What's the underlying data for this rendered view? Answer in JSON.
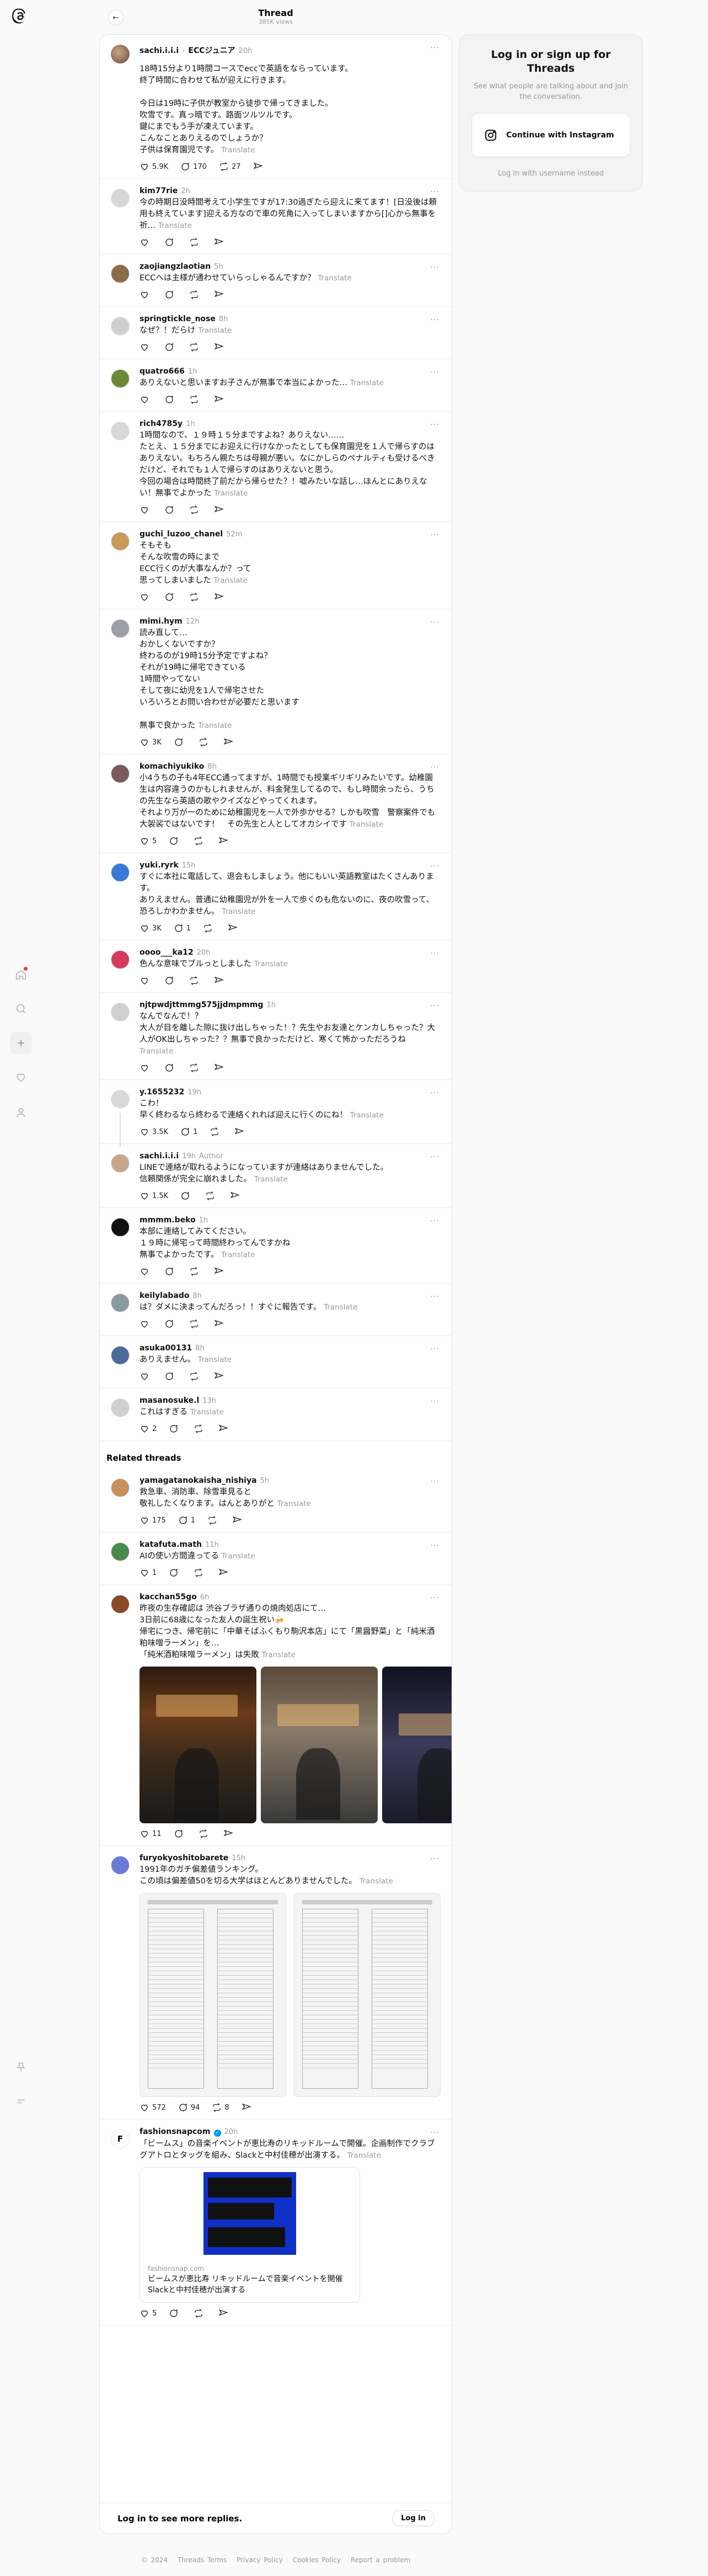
{
  "header": {
    "title": "Thread",
    "views": "385K views"
  },
  "rail": {
    "icons": [
      "home-icon",
      "search-icon",
      "create-icon",
      "heart-icon",
      "profile-icon",
      "pin-icon",
      "menu-icon"
    ]
  },
  "op": {
    "username": "sachi.i.i.i",
    "org": "ECCジュニア",
    "time": "20h",
    "text": "18時15分より1時間コースでeccで英語をならっています。\n終了時間に合わせて私が迎えに行きます。\n\n今日は19時に子供が教室から徒歩で帰ってきました。\n吹雪です。真っ暗です。路面ツルツルです。\n鍵にまでもう手が凍えています。\nこんなことありえるのでしょうか？\n子供は保育園児です。",
    "translate": "Translate",
    "likes": "5.9K",
    "replies": "170",
    "reposts": "27"
  },
  "replies": [
    {
      "user": "kim77rie",
      "time": "2h",
      "text": "今の時期日没時間考えて小学生ですが17:30過ぎたら迎えに来てます！[日没後は頼用も終えています]迎える方なので車の死角に入ってしまいますから[]心から無事を祈…",
      "translate": "Translate",
      "likes": "",
      "replies": "",
      "reposts": ""
    },
    {
      "user": "zaojiangzlaotian",
      "time": "5h",
      "text": "ECCへは主様が通わせていらっしゃるんですか？",
      "translate": "Translate",
      "likes": "",
      "replies": "",
      "reposts": ""
    },
    {
      "user": "springtickle_nose",
      "time": "8h",
      "text": "なぜ？！だらけ",
      "translate": "Translate",
      "likes": "",
      "replies": "",
      "reposts": ""
    },
    {
      "user": "quatro666",
      "time": "1h",
      "text": "ありえないと思いますお子さんが無事で本当によかった…",
      "translate": "Translate",
      "likes": "",
      "replies": "",
      "reposts": ""
    },
    {
      "user": "rich4785y",
      "time": "1h",
      "text": "1時間なので、１９時１５分まですよね？ありえない……\nたとえ、１５分までにお迎えに行けなかったとしても保育園児を１人で帰らすのはありえない。もちろん親たちは母親が悪い。なにかしらのペナルティも受けるべきだけど、それでも１人で帰らすのはありえないと思う。\n今回の場合は時間終了前だから帰らせた？！嘘みたいな話し…ほんとにありえない！無事でよかった",
      "translate": "Translate",
      "likes": "",
      "replies": "",
      "reposts": ""
    },
    {
      "user": "guchi_luzoo_chanel",
      "time": "52m",
      "text": "そもそも\nそんな吹雪の時にまで\nECC行くのが大事なんか？って\n思ってしまいました",
      "translate": "Translate",
      "likes": "",
      "replies": "",
      "reposts": ""
    },
    {
      "user": "mimi.hym",
      "time": "12h",
      "text": "読み直して…\nおかしくないですか？\n終わるのが19時15分予定ですよね？\nそれが19時に帰宅できている\n1時間やってない\nそして夜に幼児を1人で帰宅させた\nいろいろとお問い合わせが必要だと思います\n\n無事で良かった",
      "translate": "Translate",
      "likes": "3K",
      "replies": "",
      "reposts": ""
    },
    {
      "user": "komachiyukiko",
      "time": "8h",
      "text": "小4うちの子も4年ECC通ってますが、1時間でも授業ギリギリみたいです。幼稚園生は内容違うのかもしれませんが、料金発生してるので、もし時間余ったら、うちの先生なら英語の歌やクイズなどやってくれます。\nそれより万が一のために幼稚園児を一人で外歩かせる？しかも吹雪　警察案件でも大袈裟ではないです！　その先生と人としてオカシイです",
      "translate": "Translate",
      "likes": "5",
      "replies": "",
      "reposts": ""
    },
    {
      "user": "yuki.ryrk",
      "time": "15h",
      "text": "すぐに本社に電話して、退会もしましょう。他にもいい英語教室はたくさんあります。\nありえません。普通に幼稚園児が外を一人で歩くのも危ないのに、夜の吹雪って、恐ろしかわかません。",
      "translate": "Translate",
      "likes": "3K",
      "replies": "1",
      "reposts": ""
    },
    {
      "user": "oooo___ka12",
      "time": "20h",
      "text": "色んな意味でブルっとしました",
      "translate": "Translate",
      "likes": "",
      "replies": "",
      "reposts": ""
    },
    {
      "user": "njtpwdjttmmg575jjdmpmmg",
      "time": "1h",
      "text": "なんでなんで！？\n大人が目を離した隙に抜け出しちゃった！？先生やお友達とケンカしちゃった？大人がOK出しちゃった？？無事で良かっただけど、寒くて怖かっただろうね",
      "translate": "Translate",
      "likes": "",
      "replies": "",
      "reposts": ""
    },
    {
      "user": "y.1655232",
      "time": "19h",
      "text": "こわ！\n早く終わるなら終わるで連絡くれれば迎えに行くのにね！",
      "translate": "Translate",
      "likes": "3.5K",
      "replies": "1",
      "reposts": "",
      "thread": true
    },
    {
      "user": "sachi.i.i.i",
      "time": "19h",
      "author": "Author",
      "text": "LINEで連絡が取れるようになっていますが連絡はありませんでした。\n信頼関係が完全に崩れました。",
      "translate": "Translate",
      "likes": "1.5K",
      "replies": "",
      "reposts": ""
    },
    {
      "user": "mmmm.beko",
      "time": "1h",
      "text": "本部に連絡してみてください。\n１９時に帰宅って時間終わってんですかね\n無事でよかったです。",
      "translate": "Translate",
      "likes": "",
      "replies": "",
      "reposts": ""
    },
    {
      "user": "keilylabado",
      "time": "8h",
      "text": "は？ダメに決まってんだろっ！！すぐに報告です。",
      "translate": "Translate",
      "likes": "",
      "replies": "",
      "reposts": ""
    },
    {
      "user": "asuka00131",
      "time": "8h",
      "text": "ありえません。",
      "translate": "Translate",
      "likes": "",
      "replies": "",
      "reposts": ""
    },
    {
      "user": "masanosuke.l",
      "time": "13h",
      "text": "これはすぎる",
      "translate": "Translate",
      "likes": "2",
      "replies": "",
      "reposts": ""
    }
  ],
  "related": {
    "label": "Related threads",
    "items": [
      {
        "user": "yamagatanokaisha_nishiya",
        "time": "5h",
        "text": "救急車、消防車、除雪車見ると\n敬礼したくなります。はんとありがと",
        "translate": "Translate",
        "likes": "175",
        "replies": "1",
        "reposts": ""
      },
      {
        "user": "katafuta.math",
        "time": "11h",
        "text": "AIの使い方間違ってる",
        "translate": "Translate",
        "likes": "1",
        "replies": "",
        "reposts": ""
      },
      {
        "user": "kacchan55go",
        "time": "6h",
        "text": "昨夜の生存確認は 渋谷ブラザ通りの焼肉処店にて…\n3日前に68歳になった友人の誕生祝い🍻\n帰宅につき、帰宅前に「中華そばふくもり駒沢本店」にて「黒醤野菜」と「純米酒粕味噌ラーメン」を…\n「純米酒粕味噌ラーメン」は失敗",
        "translate": "Translate",
        "likes": "11",
        "replies": "",
        "reposts": ""
      },
      {
        "user": "furyokyoshitobarete",
        "time": "15h",
        "text": "1991年のガチ偏差値ランキング。\nこの頃は偏差値50を切る大学はほとんどありませんでした。",
        "translate": "Translate",
        "likes": "572",
        "replies": "94",
        "reposts": "8"
      },
      {
        "user": "fashionsnapcom",
        "time": "20h",
        "text": "「ビームス」の音楽イベントが恵比寿のリキッドルームで開催。企画制作でクラブグアトロとタッグを組み、Slackと中村佳穂が出演する。",
        "translate": "Translate",
        "likes": "5",
        "replies": "",
        "reposts": "",
        "link": {
          "domain": "fashionsnap.com",
          "title": "ビームスが恵比寿 リキッドルームで音楽イベントを開催　Slackと中村佳穂が出演する"
        }
      }
    ]
  },
  "login_bar": {
    "text": "Log in to see more replies.",
    "button": "Log in"
  },
  "side": {
    "title": "Log in or sign up for Threads",
    "subtitle": "See what people are talking about and join the conversation.",
    "ig_button": "Continue with Instagram",
    "alt": "Log in with username instead"
  },
  "footer": [
    "© 2024",
    "Threads Terms",
    "Privacy Policy",
    "Cookies Policy",
    "Report a problem"
  ],
  "colors": {
    "verified": "#0095f6",
    "notification": "#ff3040",
    "poster_blue": "#1030c8"
  }
}
